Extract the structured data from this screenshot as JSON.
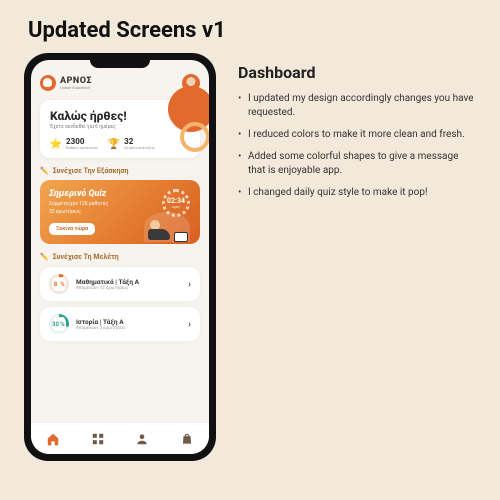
{
  "page": {
    "title": "Updated Screens v1"
  },
  "right": {
    "heading": "Dashboard",
    "bullets": [
      "I updated my design accordingly changes you have requested.",
      "I reduced colors to make it more clean and fresh.",
      "Added some colorful shapes to give a message that is enjoyable app.",
      "I changed daily quiz style to make it pop!"
    ]
  },
  "app": {
    "brand_name": "ΑΡΝΟΣ",
    "brand_sub": "Online Education",
    "welcome": {
      "title": "Καλώς ήρθες!",
      "subtitle": "Έχετε συνδεθεί για 6 ημέρες",
      "stat1_value": "2300",
      "stat1_label": "Βαθμοί εμπειρίας",
      "stat2_value": "32",
      "stat2_label": "Σειρά κατάταξης"
    },
    "practice_heading": "Συνέχισε Την Εξάσκηση",
    "quiz": {
      "title": "Σημερινό Quiz",
      "line1": "Συμμετείχαν 120 μαθητές",
      "line2": "32 ερωτήσεις",
      "button": "Ξεκίνα τώρα",
      "timer_value": "02:34",
      "timer_label": "ωρες"
    },
    "study_heading": "Συνέχισε Τη Μελέτη",
    "study": [
      {
        "pct": "8",
        "pct_suffix": "%",
        "title": "Μαθηματικά | Τάξη Α",
        "sub": "Απομένουν 12 ερωτήσεις"
      },
      {
        "pct": "30",
        "pct_suffix": "%",
        "title": "Ιστορία | Τάξη Α",
        "sub": "Απομένουν 5 ερωτήσεις"
      }
    ]
  }
}
